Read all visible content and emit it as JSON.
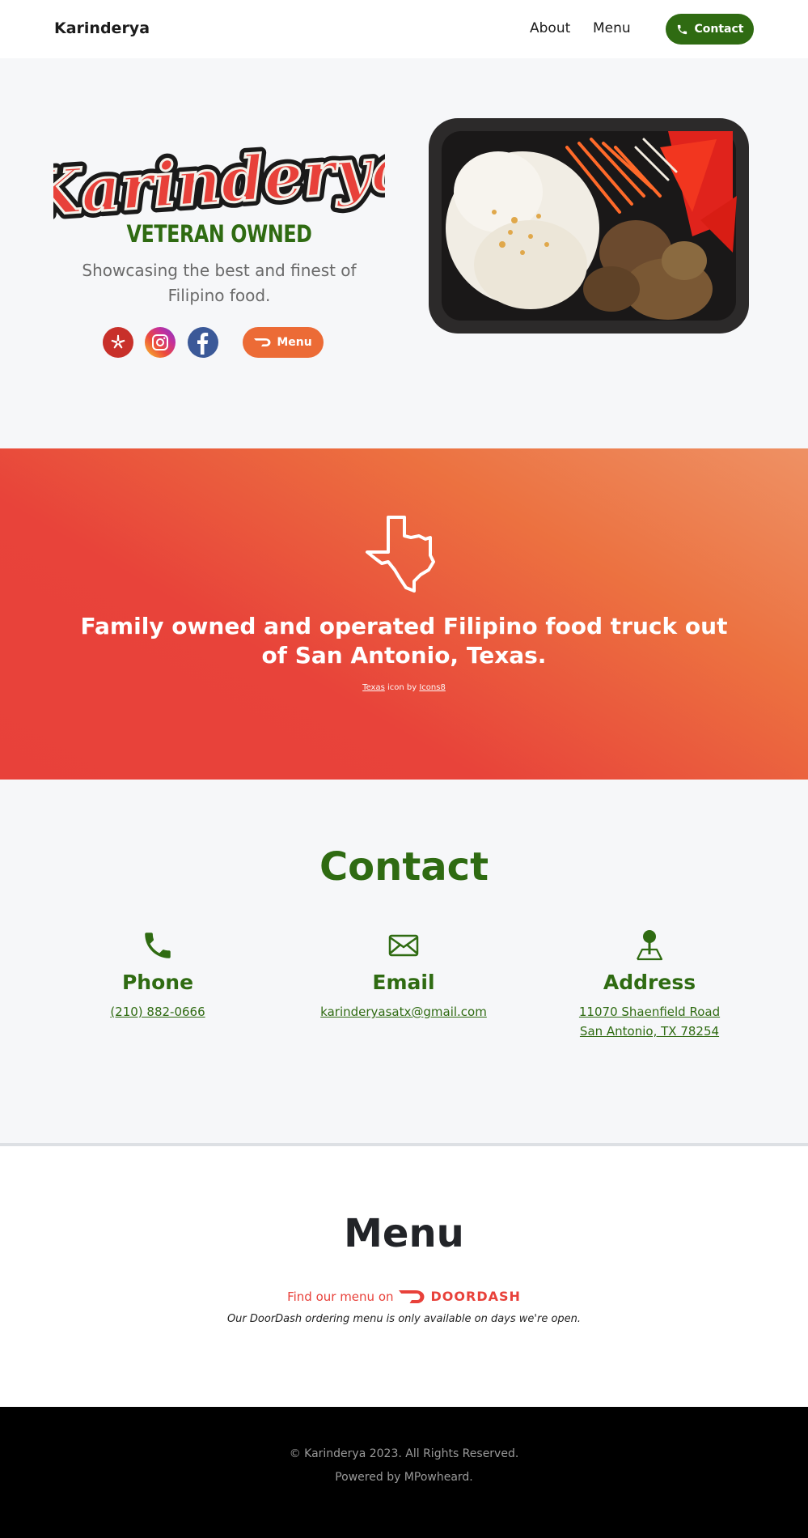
{
  "nav": {
    "brand": "Karinderya",
    "about_label": "About",
    "menu_label": "Menu",
    "contact_label": "Contact"
  },
  "hero": {
    "logo_text": "Karinderya",
    "veteran_label": "VETERAN OWNED",
    "tagline": "Showcasing the best and finest of Filipino food.",
    "menu_button_label": "Menu",
    "social_icons": [
      "yelp-icon",
      "instagram-icon",
      "facebook-icon"
    ]
  },
  "banner": {
    "headline": "Family owned and operated Filipino food truck out of San Antonio, Texas.",
    "credit_link1": "Texas",
    "credit_mid": " icon by ",
    "credit_link2": "Icons8"
  },
  "contact": {
    "title": "Contact",
    "phone": {
      "heading": "Phone",
      "value": "(210) 882-0666"
    },
    "email": {
      "heading": "Email",
      "value": "karinderyasatx@gmail.com"
    },
    "address": {
      "heading": "Address",
      "line1": "11070 Shaenfield Road",
      "line2": "San Antonio, TX 78254"
    }
  },
  "menu": {
    "title": "Menu",
    "find_text": "Find our menu on",
    "doordash_label": "DOORDASH",
    "note": "Our DoorDash ordering menu is only available on days we're open."
  },
  "footer": {
    "copyright": "© Karinderya 2023. All Rights Reserved.",
    "powered": "Powered by MPowheard."
  },
  "colors": {
    "brand_green": "#2f6b12",
    "brand_orange": "#ec6b36",
    "banner_red": "#e8413a",
    "doordash_red": "#e8413a"
  }
}
